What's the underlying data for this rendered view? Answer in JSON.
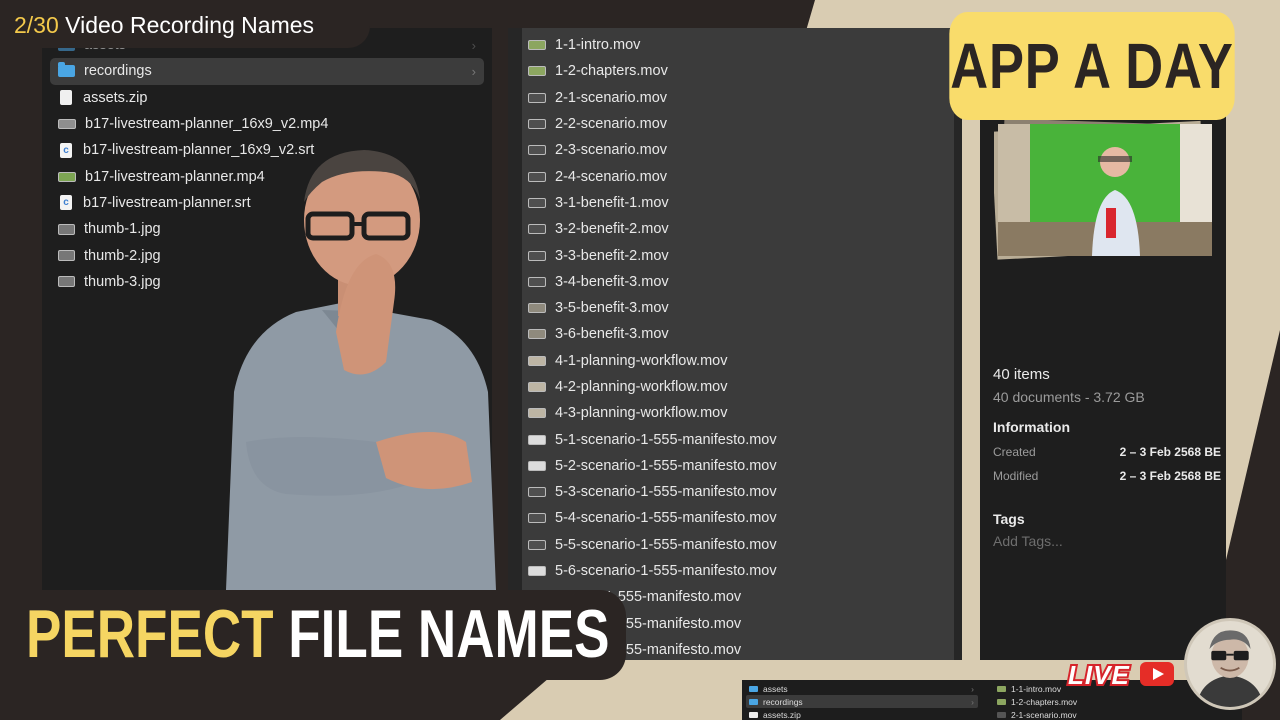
{
  "episode": {
    "count": "2/30",
    "title": "Video Recording Names"
  },
  "brand": {
    "badge": "APP A DAY",
    "live": "LIVE"
  },
  "headline": {
    "word1": "PERFECT",
    "word2": "FILE NAMES"
  },
  "colors": {
    "background": "#2b2523",
    "beige": "#d9ccb2",
    "accent_yellow": "#f9dc6b",
    "folder_blue": "#4aa6e4",
    "live_red": "#e52d27"
  },
  "left_pane": {
    "items": [
      {
        "label": "assets",
        "icon": "folder-icon",
        "chevron": "›",
        "dim": true
      },
      {
        "label": "recordings",
        "icon": "folder-icon",
        "chevron": "›",
        "selected": true
      },
      {
        "label": "assets.zip",
        "icon": "zip-file-icon"
      },
      {
        "label": "b17-livestream-planner_16x9_v2.mp4",
        "icon": "video-file-icon"
      },
      {
        "label": "b17-livestream-planner_16x9_v2.srt",
        "icon": "srt-file-icon"
      },
      {
        "label": "b17-livestream-planner.mp4",
        "icon": "video-file-icon"
      },
      {
        "label": "b17-livestream-planner.srt",
        "icon": "srt-file-icon"
      },
      {
        "label": "thumb-1.jpg",
        "icon": "image-file-icon"
      },
      {
        "label": "thumb-2.jpg",
        "icon": "image-file-icon"
      },
      {
        "label": "thumb-3.jpg",
        "icon": "image-file-icon"
      }
    ]
  },
  "mid_pane": {
    "files": [
      "1-1-intro.mov",
      "1-2-chapters.mov",
      "2-1-scenario.mov",
      "2-2-scenario.mov",
      "2-3-scenario.mov",
      "2-4-scenario.mov",
      "3-1-benefit-1.mov",
      "3-2-benefit-2.mov",
      "3-3-benefit-2.mov",
      "3-4-benefit-3.mov",
      "3-5-benefit-3.mov",
      "3-6-benefit-3.mov",
      "4-1-planning-workflow.mov",
      "4-2-planning-workflow.mov",
      "4-3-planning-workflow.mov",
      "5-1-scenario-1-555-manifesto.mov",
      "5-2-scenario-1-555-manifesto.mov",
      "5-3-scenario-1-555-manifesto.mov",
      "5-4-scenario-1-555-manifesto.mov",
      "5-5-scenario-1-555-manifesto.mov",
      "5-6-scenario-1-555-manifesto.mov",
      "rio-1-555-manifesto.mov",
      "rio-1-555-manifesto.mov",
      "rio-1-555-manifesto.mov"
    ]
  },
  "info_pane": {
    "items_count": "40 items",
    "docs_summary": "40 documents - 3.72 GB",
    "information_header": "Information",
    "created_label": "Created",
    "created_value": "2 – 3 Feb 2568 BE",
    "modified_label": "Modified",
    "modified_value": "2 – 3 Feb 2568 BE",
    "tags_header": "Tags",
    "tags_placeholder": "Add Tags..."
  },
  "mini_finder": {
    "left": [
      {
        "label": "assets",
        "chevron": "›"
      },
      {
        "label": "recordings",
        "chevron": "›",
        "selected": true
      },
      {
        "label": "assets.zip"
      }
    ],
    "right": [
      "1-1-intro.mov",
      "1-2-chapters.mov",
      "2-1-scenario.mov"
    ]
  }
}
